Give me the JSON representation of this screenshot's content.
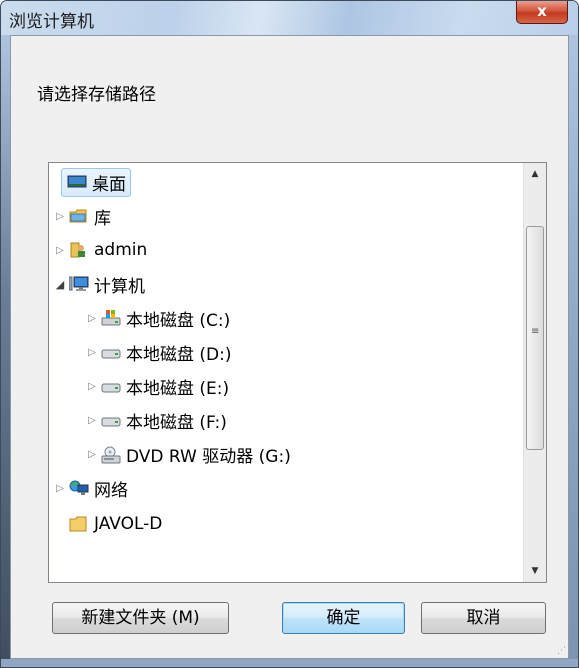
{
  "window": {
    "title": "浏览计算机",
    "close_label": "x"
  },
  "prompt": "请选择存储路径",
  "tree": {
    "items": [
      {
        "label": "桌面",
        "icon": "desktop-icon",
        "expander": "",
        "selected": true
      },
      {
        "label": "库",
        "icon": "library-icon",
        "expander": "▷"
      },
      {
        "label": "admin",
        "icon": "user-folder-icon",
        "expander": "▷"
      },
      {
        "label": "计算机",
        "icon": "computer-icon",
        "expander": "◢"
      },
      {
        "label": "本地磁盘 (C:)",
        "icon": "system-drive-icon",
        "expander": "▷"
      },
      {
        "label": "本地磁盘 (D:)",
        "icon": "drive-icon",
        "expander": "▷"
      },
      {
        "label": "本地磁盘 (E:)",
        "icon": "drive-icon",
        "expander": "▷"
      },
      {
        "label": "本地磁盘 (F:)",
        "icon": "drive-icon",
        "expander": "▷"
      },
      {
        "label": "DVD RW 驱动器 (G:)",
        "icon": "dvd-drive-icon",
        "expander": "▷"
      },
      {
        "label": "网络",
        "icon": "network-icon",
        "expander": "▷"
      },
      {
        "label": "JAVOL-D",
        "icon": "folder-icon",
        "expander": ""
      }
    ]
  },
  "buttons": {
    "new_folder": "新建文件夹 (M)",
    "ok": "确定",
    "cancel": "取消"
  },
  "colors": {
    "selection": "#d9ecfc",
    "default_button": "#bee4f9",
    "close_button": "#c2391f"
  }
}
